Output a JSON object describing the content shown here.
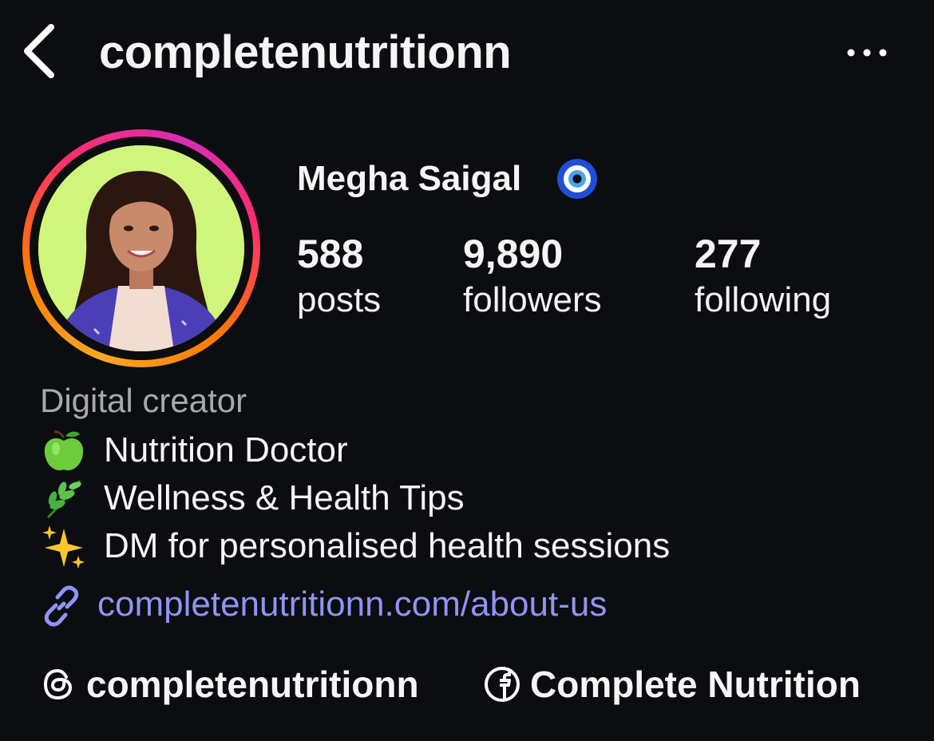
{
  "header": {
    "username": "completenutritionn",
    "back_icon": "chevron-left-icon",
    "more_icon": "more-horizontal-icon"
  },
  "profile": {
    "display_name": "Megha Saigal",
    "name_emoji": "nazar-amulet-emoji",
    "avatar": "profile-photo",
    "story_ring_colors": [
      "#f9a825",
      "#ff2d6f",
      "#d62eb5"
    ]
  },
  "stats": [
    {
      "value": "588",
      "label": "posts"
    },
    {
      "value": "9,890",
      "label": "followers"
    },
    {
      "value": "277",
      "label": "following"
    }
  ],
  "bio": {
    "category": "Digital creator",
    "lines": [
      {
        "emoji": "green-apple-emoji",
        "text": "Nutrition Doctor"
      },
      {
        "emoji": "herb-emoji",
        "text": "Wellness & Health Tips"
      },
      {
        "emoji": "sparkles-emoji",
        "text": "DM for personalised health sessions"
      }
    ],
    "link": "completenutritionn.com/about-us",
    "link_color": "#8f94f5"
  },
  "social": {
    "threads": {
      "icon": "threads-icon",
      "label": "completenutritionn"
    },
    "facebook": {
      "icon": "facebook-icon",
      "label": "Complete Nutrition"
    }
  }
}
